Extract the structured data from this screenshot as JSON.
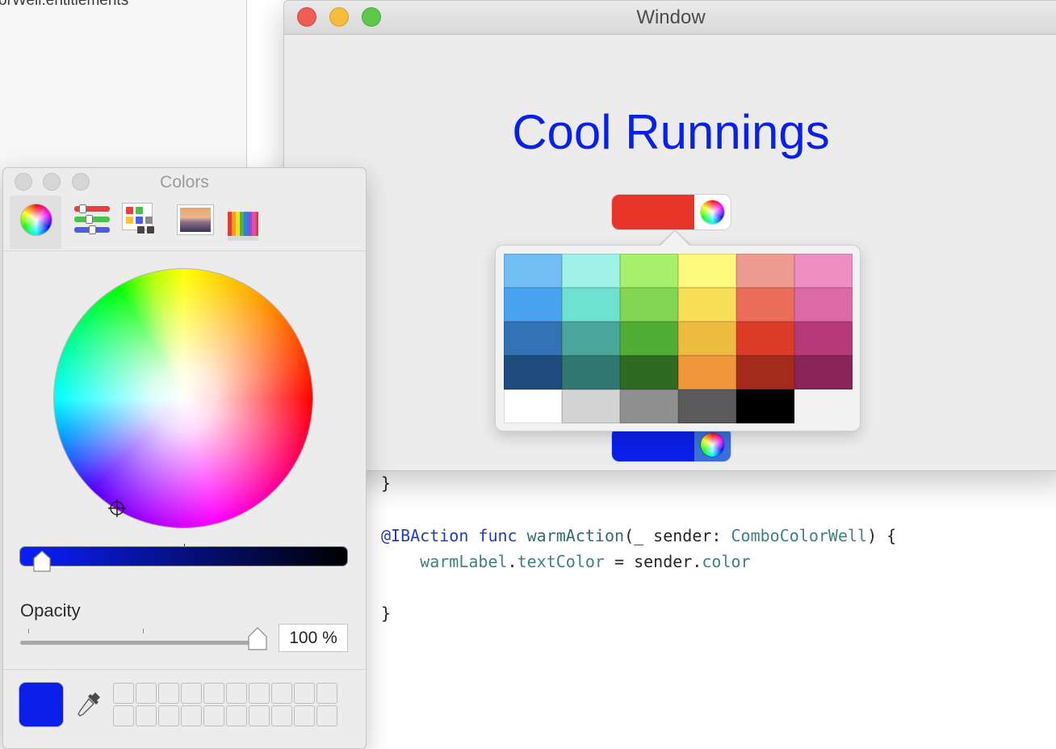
{
  "navigator": {
    "file_name": "orWell.entitlements"
  },
  "code": {
    "line1": "}",
    "line2_kw": "@IBAction",
    "line2_func": "func",
    "line2_name": "warmAction",
    "line2_args": "(_ sender: ",
    "line2_type": "ComboColorWell",
    "line2_end": ") {",
    "line3_obj": "warmLabel",
    "line3_dot": ".",
    "line3_prop": "textColor",
    "line3_mid": " = sender.",
    "line3_prop2": "color",
    "line4": "}"
  },
  "window": {
    "title": "Window",
    "label_text": "Cool Runnings",
    "label_color": "#0a1fe8",
    "warm_well_color": "#e8352a",
    "cool_well_color": "#0a1fe8",
    "cool_well_button_color": "#3a6fd8"
  },
  "popover": {
    "swatches": [
      "#73bdf7",
      "#9ef3e6",
      "#a6f06b",
      "#fff97d",
      "#ee9b91",
      "#ee8fc2",
      "#4ba2f1",
      "#6fe1d0",
      "#83d554",
      "#f6df57",
      "#eb6e59",
      "#dd6aa6",
      "#3272b5",
      "#4aa59b",
      "#52ad36",
      "#eebb41",
      "#dc3b28",
      "#b63978",
      "#1e4c7e",
      "#2f7770",
      "#2e6b21",
      "#f0973a",
      "#a42a1c",
      "#8a2459",
      "#ffffff",
      "#d3d3d3",
      "#8f8f8f",
      "#5a5a5a",
      "#000000",
      ""
    ]
  },
  "colors_panel": {
    "title": "Colors",
    "opacity_label": "Opacity",
    "opacity_value": "100 %",
    "opacity_percent": 100,
    "brightness_fraction": 0.0,
    "current_color": "#0a1fe8",
    "favorite_slots": 20
  }
}
